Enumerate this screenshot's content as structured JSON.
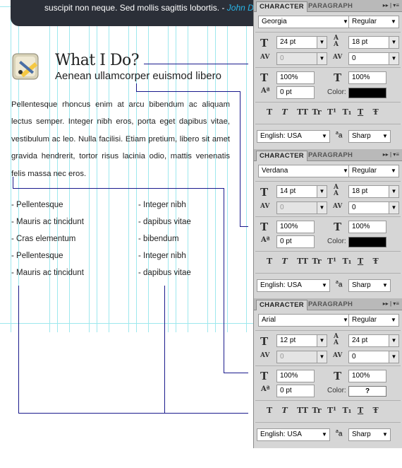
{
  "canvas": {
    "top_quote_text": "suscipit non neque. Sed mollis sagittis lobortis. - ",
    "top_quote_author": "John D",
    "heading": "What I Do?",
    "subheading": "Aenean ullamcorper euismod libero",
    "paragraph": "Pellentesque rhoncus enim at arcu bibendum ac aliquam lectus semper. Integer nibh eros, porta eget dapibus vitae, vestibulum ac leo. Nulla facilisi. Etiam pretium, libero sit amet gravida hendrerit, tortor risus lacinia odio, mattis venenatis felis massa nec eros.",
    "list_left": [
      "- Pellentesque",
      "- Mauris ac tincidunt",
      "- Cras elementum",
      "- Pellentesque",
      "- Mauris ac tincidunt"
    ],
    "list_right": [
      "- Integer nibh",
      "- dapibus vitae",
      "- bibendum",
      "- Integer nibh",
      "- dapibus vitae"
    ]
  },
  "panel_labels": {
    "tab_character": "CHARACTER",
    "tab_paragraph": "PARAGRAPH",
    "color_label": "Color:"
  },
  "panels": [
    {
      "font_family": "Georgia",
      "font_style": "Regular",
      "size": "24 pt",
      "leading": "18 pt",
      "kerning": "0",
      "tracking": "0",
      "vscale": "100%",
      "hscale": "100%",
      "baseline": "0 pt",
      "color": "#000000",
      "color_text": "",
      "language": "English: USA",
      "aa_label": "a",
      "antialias": "Sharp"
    },
    {
      "font_family": "Verdana",
      "font_style": "Regular",
      "size": "14 pt",
      "leading": "18 pt",
      "kerning": "0",
      "tracking": "0",
      "vscale": "100%",
      "hscale": "100%",
      "baseline": "0 pt",
      "color": "#000000",
      "color_text": "",
      "language": "English: USA",
      "aa_label": "a",
      "antialias": "Sharp"
    },
    {
      "font_family": "Arial",
      "font_style": "Regular",
      "size": "12 pt",
      "leading": "24 pt",
      "kerning": "0",
      "tracking": "0",
      "vscale": "100%",
      "hscale": "100%",
      "baseline": "0 pt",
      "color": "#ffffff",
      "color_text": "?",
      "language": "English: USA",
      "aa_label": "a",
      "antialias": "Sharp"
    }
  ],
  "style_buttons": [
    "T",
    "T",
    "TT",
    "Tr",
    "T¹",
    "T₁",
    "T",
    "Ŧ"
  ],
  "colors": {
    "guide": "#9ee8ee",
    "annotation_line": "#1a1a8c",
    "topbar": "#2b2f38",
    "accent": "#29b6e8"
  }
}
